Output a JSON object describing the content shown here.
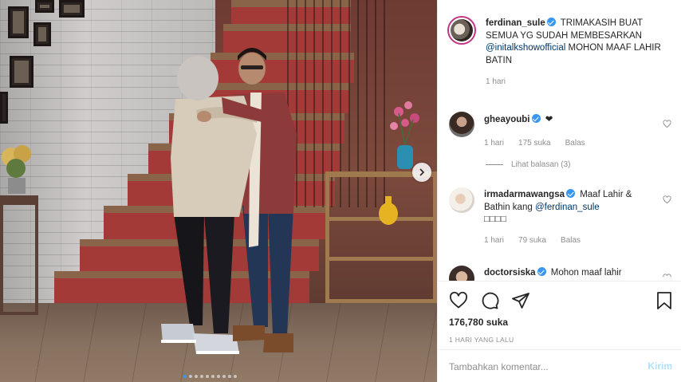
{
  "post": {
    "author": "ferdinan_sule",
    "caption_text": "TRIMAKASIH BUAT SEMUA YG SUDAH MEMBESARKAN",
    "caption_mention": "@initalkshowofficial",
    "caption_end": "MOHON MAAF LAHIR BATIN",
    "caption_age": "1 hari",
    "likes": "176,780 suka",
    "timestamp": "1 HARI YANG LALU"
  },
  "comments": [
    {
      "username": "gheayoubi",
      "text": "❤",
      "age": "1 hari",
      "likes": "175 suka",
      "reply": "Balas",
      "view_replies": "Lihat balasan (3)"
    },
    {
      "username": "irmadarmawangsa",
      "text": "Maaf Lahir & Bathin kang",
      "mention": "@ferdinan_sule",
      "extra": "□□□□",
      "age": "1 hari",
      "likes": "79 suka",
      "reply": "Balas"
    },
    {
      "username": "doctorsiska",
      "text": "Mohon maaf lahir"
    }
  ],
  "comment_form": {
    "placeholder": "Tambahkan komentar...",
    "submit": "Kirim"
  },
  "colors": {
    "link": "#003569",
    "verified": "#3897f0",
    "muted": "#8e8e8e",
    "submit_disabled": "#b2dffc"
  },
  "icons": [
    "heart-icon",
    "comment-icon",
    "share-icon",
    "bookmark-icon",
    "chevron-right-icon",
    "verified-icon"
  ]
}
